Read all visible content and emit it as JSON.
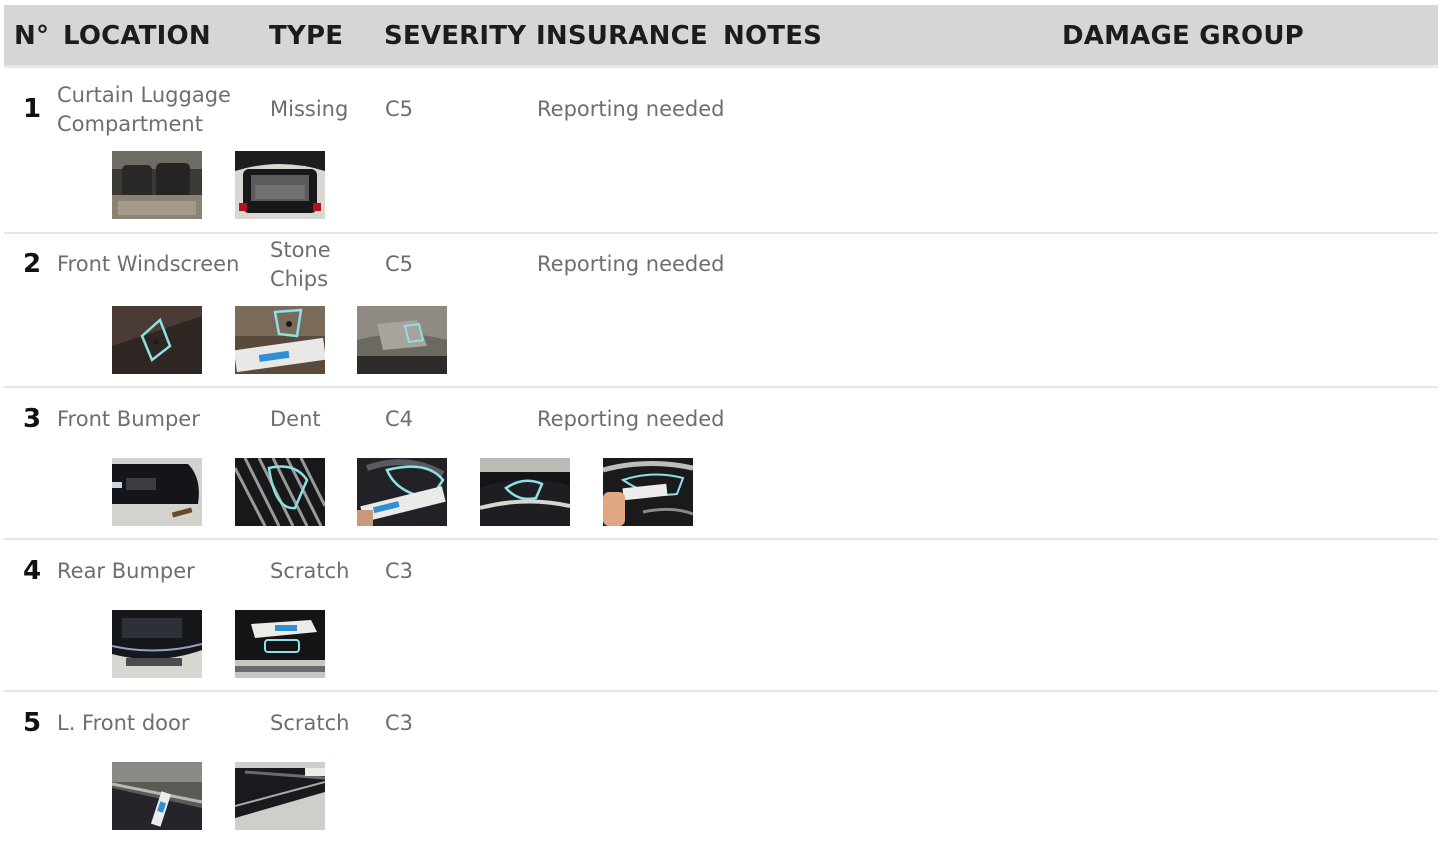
{
  "header": {
    "col_number": "N°",
    "col_location": "LOCATION",
    "col_type": "TYPE",
    "col_severity": "SEVERITY",
    "col_insurance": "INSURANCE",
    "col_notes": "NOTES",
    "col_damage_group": "DAMAGE GROUP"
  },
  "rows": [
    {
      "number": "1",
      "location": "Curtain Luggage Compartment",
      "type": "Missing",
      "severity": "C5",
      "insurance": "Reporting needed",
      "photos": [
        "rear-seat-interior-photo",
        "open-trunk-photo"
      ]
    },
    {
      "number": "2",
      "location": "Front Windscreen",
      "type": "Stone Chips",
      "severity": "C5",
      "insurance": "Reporting needed",
      "photos": [
        "windscreen-chip-closeup-photo",
        "windscreen-chip-ruler-photo",
        "windscreen-overview-photo"
      ]
    },
    {
      "number": "3",
      "location": "Front Bumper",
      "type": "Dent",
      "severity": "C4",
      "insurance": "Reporting needed",
      "photos": [
        "front-bumper-overview-photo",
        "front-grille-closeup-photo",
        "bumper-dent-ruler-photo",
        "bumper-dent-marked-photo",
        "bumper-dent-hand-ruler-photo"
      ]
    },
    {
      "number": "4",
      "location": "Rear Bumper",
      "type": "Scratch",
      "severity": "C3",
      "insurance": "",
      "photos": [
        "rear-bumper-overview-photo",
        "rear-bumper-ruler-photo"
      ]
    },
    {
      "number": "5",
      "location": "L. Front door",
      "type": "Scratch",
      "severity": "C3",
      "insurance": "",
      "photos": [
        "door-scratch-ruler-photo",
        "door-scratch-closeup-photo"
      ]
    }
  ]
}
